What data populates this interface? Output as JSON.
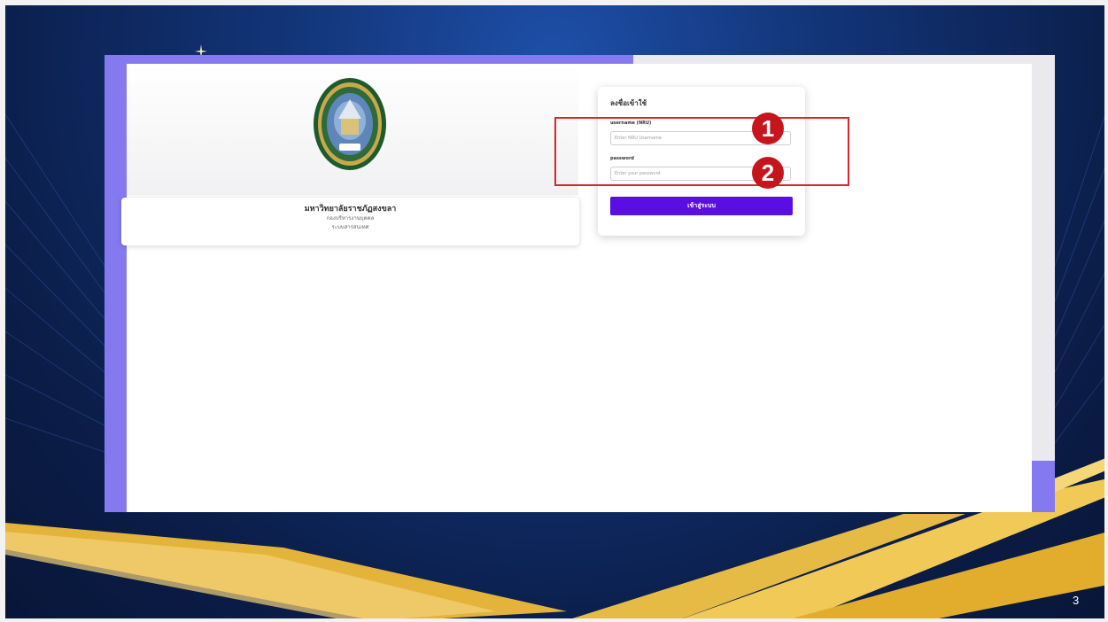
{
  "university": {
    "name": "มหาวิทยาลัยราชภัฏสงขลา",
    "department": "กองบริหารงานบุคคล",
    "subtitle": "ระบบสารสนเทศ"
  },
  "login": {
    "title": "ลงชื่อเข้าใช้",
    "username_label": "username (NRU)",
    "username_placeholder": "Enter NRU Username",
    "username_value": "",
    "password_label": "password",
    "password_placeholder": "Enter your password",
    "password_value": "",
    "submit_label": "เข้าสู่ระบบ"
  },
  "annotations": {
    "step1": "1",
    "step2": "2"
  },
  "slide": {
    "page_number": "3"
  },
  "colors": {
    "accent_purple": "#8479ee",
    "button_purple": "#5b0ee3",
    "highlight_red": "#d7262e",
    "badge_red": "#c4161c",
    "slide_navy": "#0c2150",
    "gold": "#e5b52e"
  },
  "icons": {
    "seal": "university-seal-icon",
    "sparkle": "sparkle-icon"
  }
}
